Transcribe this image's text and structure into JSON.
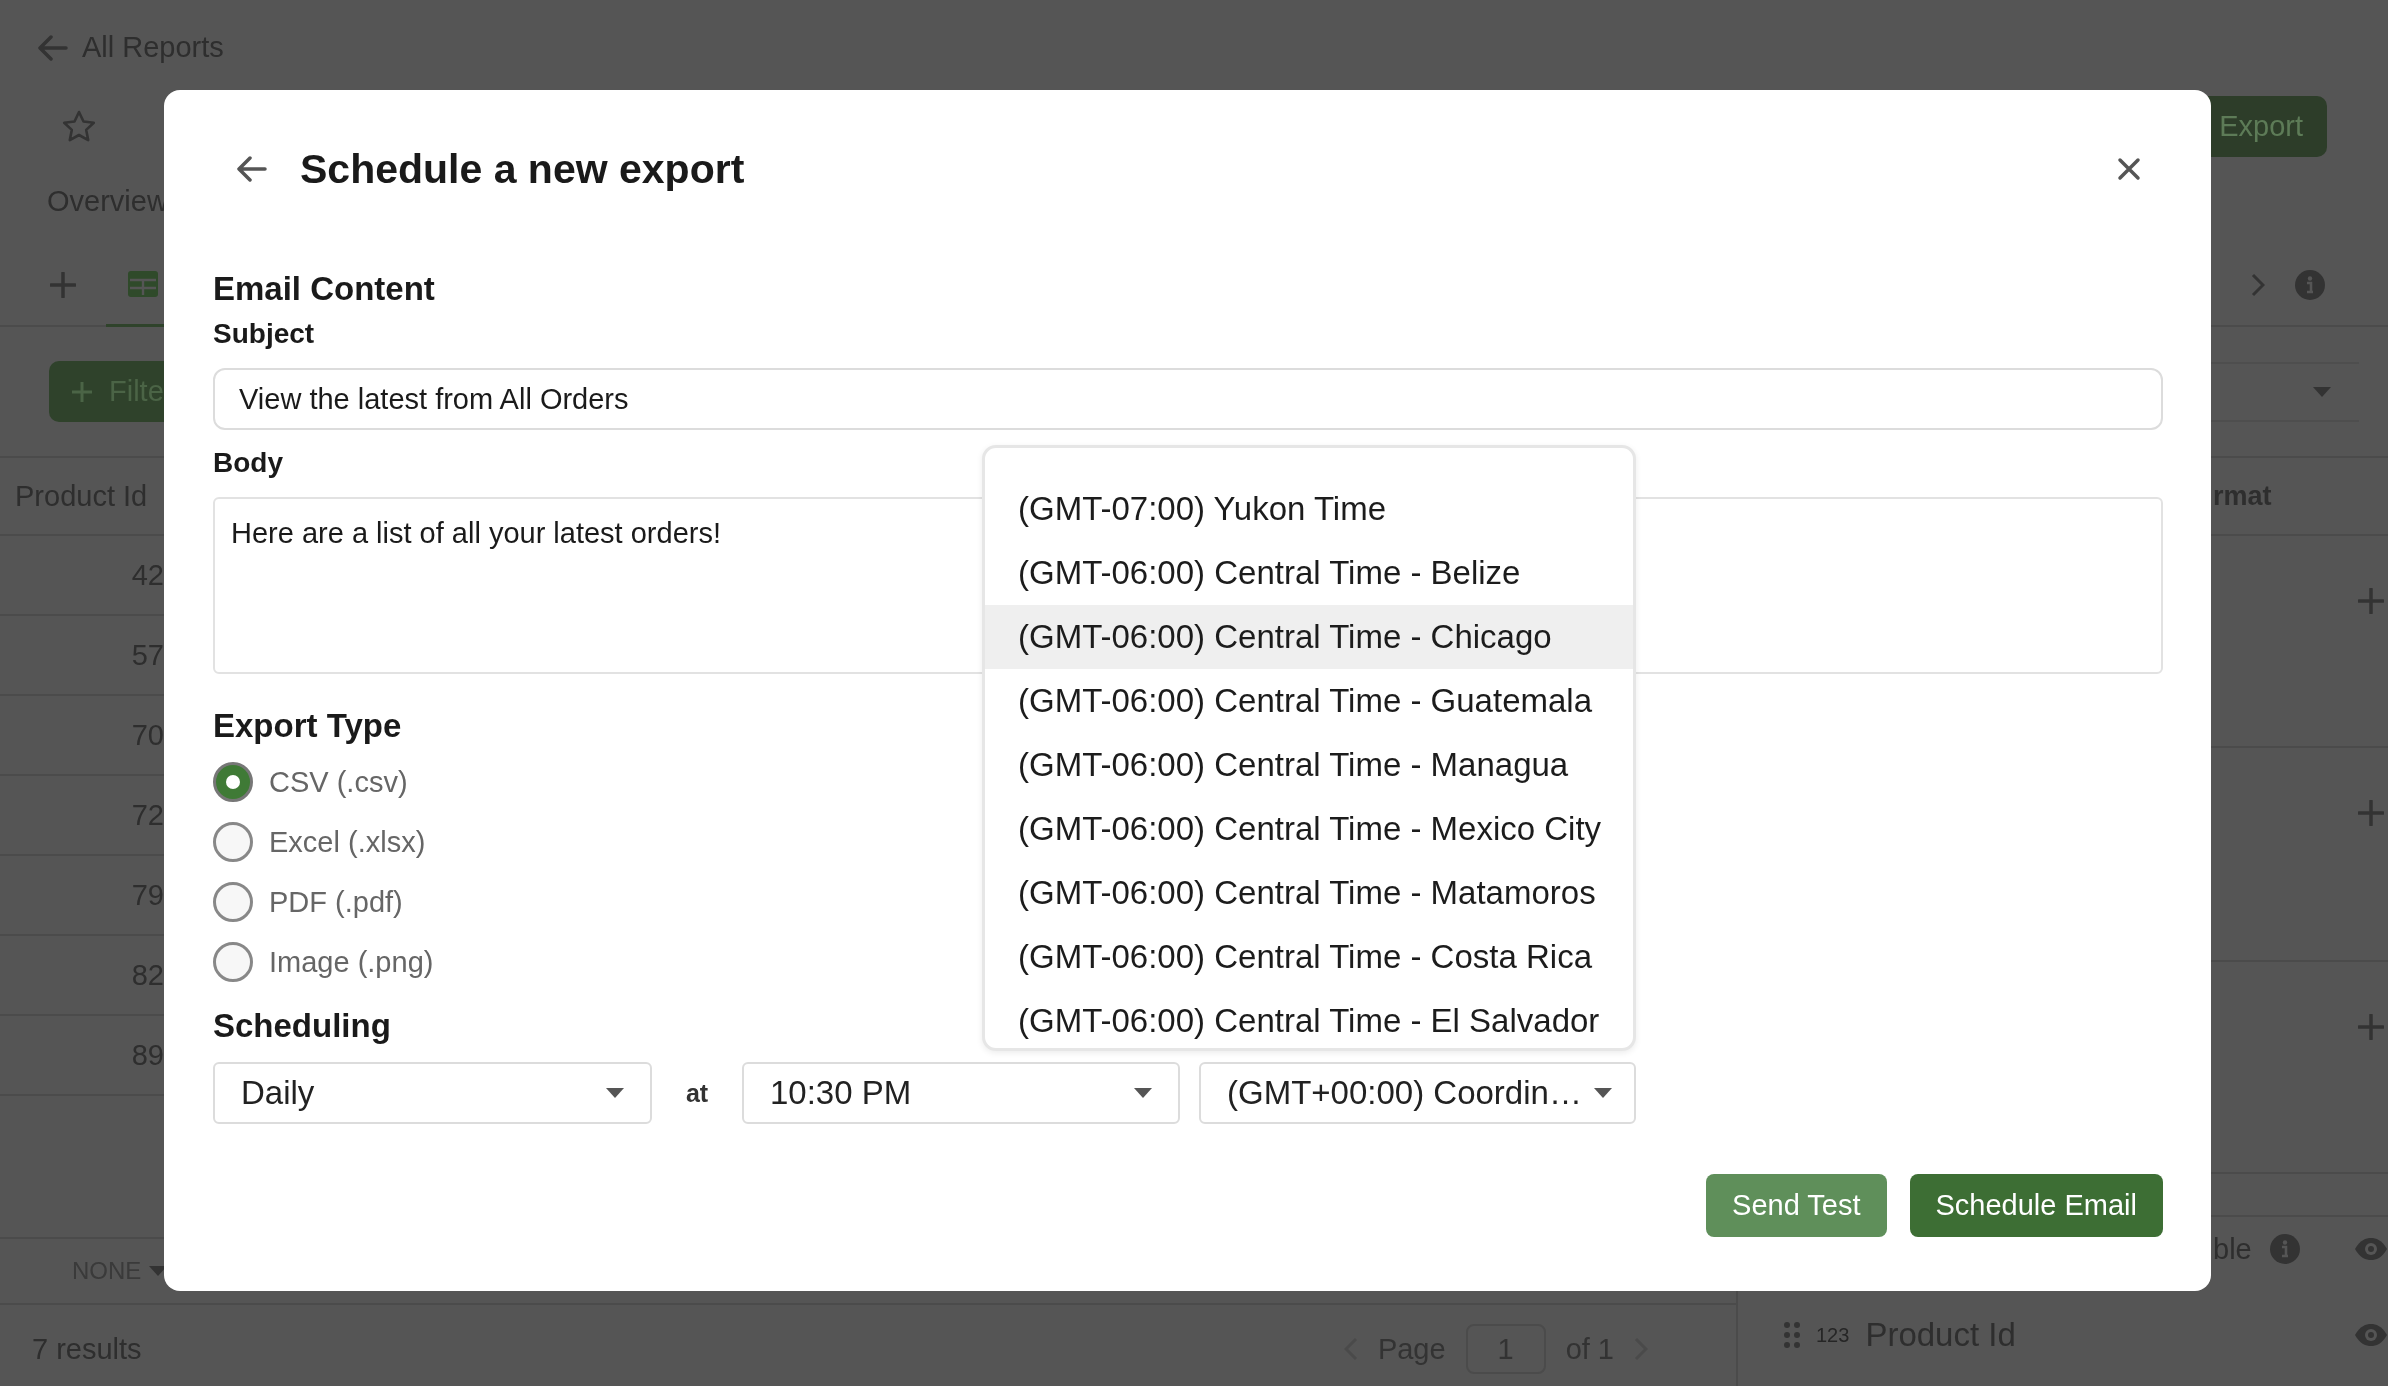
{
  "background": {
    "back_link": "All Reports",
    "tab": "Overview",
    "export_button": "Export",
    "filter_button": "Filte",
    "table": {
      "header": "Product Id",
      "cells": [
        "42",
        "57",
        "70",
        "72",
        "79",
        "82",
        "89"
      ]
    },
    "footer": {
      "dropdown": "NONE",
      "results": "7 results",
      "page_label": "Page",
      "page": "1",
      "page_total": "of 1"
    },
    "side_panel": {
      "header": "rmat",
      "row_label": "ble",
      "field": {
        "type_label": "123",
        "name": "Product Id"
      }
    }
  },
  "dialog": {
    "title": "Schedule a new export",
    "section": "Email Content",
    "subject": {
      "label": "Subject",
      "value": "View the latest from All Orders"
    },
    "body": {
      "label": "Body",
      "value": "Here are a list of all your latest orders!"
    },
    "export_type": {
      "label": "Export Type",
      "options": [
        {
          "label": "CSV (.csv)",
          "selected": true
        },
        {
          "label": "Excel (.xlsx)",
          "selected": false
        },
        {
          "label": "PDF (.pdf)",
          "selected": false
        },
        {
          "label": "Image (.png)",
          "selected": false
        }
      ]
    },
    "scheduling": {
      "label": "Scheduling",
      "frequency": "Daily",
      "at": "at",
      "time": "10:30 PM",
      "timezone": "(GMT+00:00) Coordin…"
    },
    "timezone_menu": [
      {
        "label": "(GMT-07:00) Yukon Time",
        "selected": false
      },
      {
        "label": "(GMT-06:00) Central Time - Belize",
        "selected": false
      },
      {
        "label": "(GMT-06:00) Central Time - Chicago",
        "selected": true
      },
      {
        "label": "(GMT-06:00) Central Time - Guatemala",
        "selected": false
      },
      {
        "label": "(GMT-06:00) Central Time - Managua",
        "selected": false
      },
      {
        "label": "(GMT-06:00) Central Time - Mexico City",
        "selected": false
      },
      {
        "label": "(GMT-06:00) Central Time - Matamoros",
        "selected": false
      },
      {
        "label": "(GMT-06:00) Central Time - Costa Rica",
        "selected": false
      },
      {
        "label": "(GMT-06:00) Central Time - El Salvador",
        "selected": false
      }
    ],
    "buttons": [
      {
        "label": "Send Test",
        "kind": "secondary"
      },
      {
        "label": "Schedule Email",
        "kind": "primary"
      }
    ]
  }
}
